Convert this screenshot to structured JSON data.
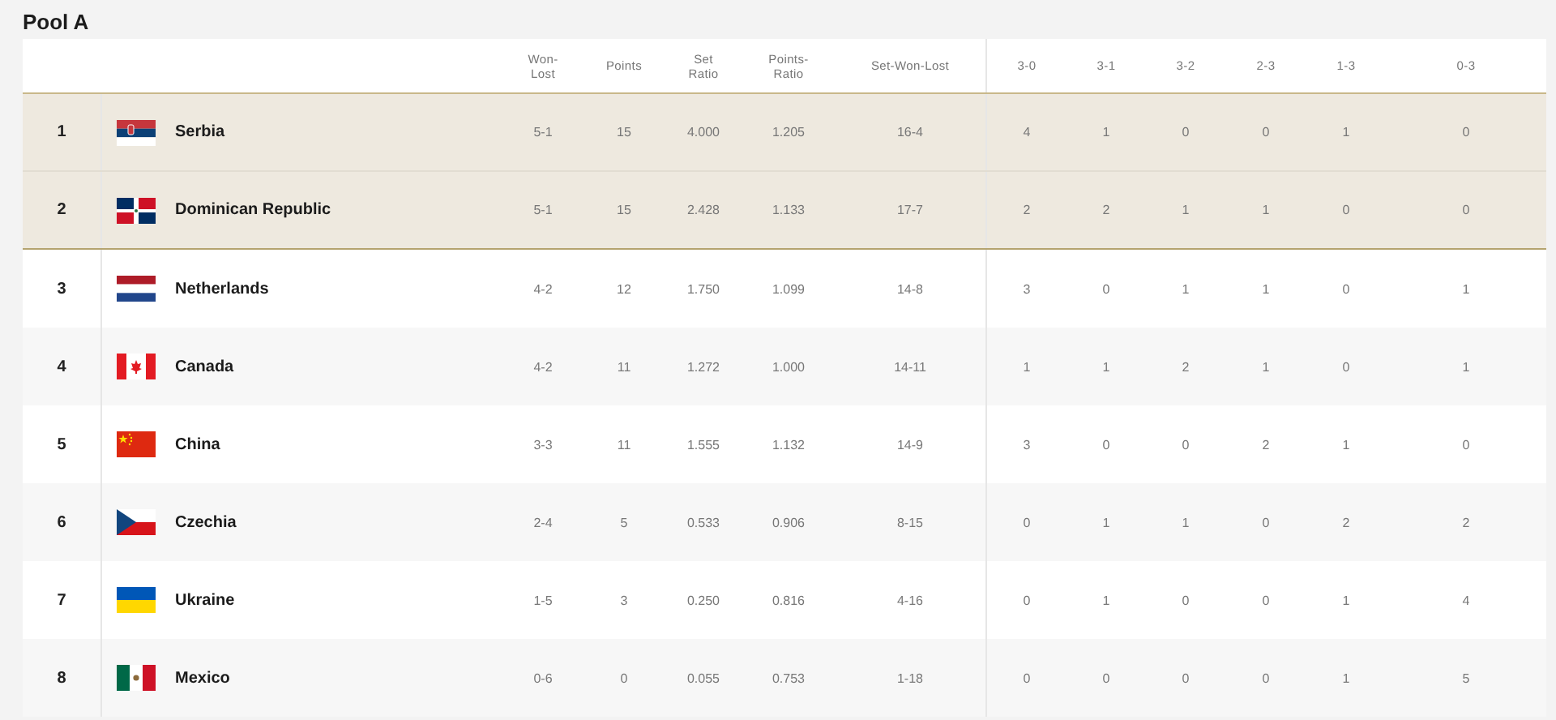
{
  "title": "Pool A",
  "columns": [
    "Won-\nLost",
    "Points",
    "Set\nRatio",
    "Points-\nRatio",
    "Set-Won-Lost",
    "3-0",
    "3-1",
    "3-2",
    "2-3",
    "1-3",
    "0-3"
  ],
  "rows": [
    {
      "rank": "1",
      "team": "Serbia",
      "highlighted": true,
      "stats": [
        "5-1",
        "15",
        "4.000",
        "1.205",
        "16-4",
        "4",
        "1",
        "0",
        "0",
        "1",
        "0"
      ]
    },
    {
      "rank": "2",
      "team": "Dominican Republic",
      "highlighted": true,
      "stats": [
        "5-1",
        "15",
        "2.428",
        "1.133",
        "17-7",
        "2",
        "2",
        "1",
        "1",
        "0",
        "0"
      ]
    },
    {
      "rank": "3",
      "team": "Netherlands",
      "highlighted": false,
      "stats": [
        "4-2",
        "12",
        "1.750",
        "1.099",
        "14-8",
        "3",
        "0",
        "1",
        "1",
        "0",
        "1"
      ]
    },
    {
      "rank": "4",
      "team": "Canada",
      "highlighted": false,
      "stats": [
        "4-2",
        "11",
        "1.272",
        "1.000",
        "14-11",
        "1",
        "1",
        "2",
        "1",
        "0",
        "1"
      ]
    },
    {
      "rank": "5",
      "team": "China",
      "highlighted": false,
      "stats": [
        "3-3",
        "11",
        "1.555",
        "1.132",
        "14-9",
        "3",
        "0",
        "0",
        "2",
        "1",
        "0"
      ]
    },
    {
      "rank": "6",
      "team": "Czechia",
      "highlighted": false,
      "stats": [
        "2-4",
        "5",
        "0.533",
        "0.906",
        "8-15",
        "0",
        "1",
        "1",
        "0",
        "2",
        "2"
      ]
    },
    {
      "rank": "7",
      "team": "Ukraine",
      "highlighted": false,
      "stats": [
        "1-5",
        "3",
        "0.250",
        "0.816",
        "4-16",
        "0",
        "1",
        "0",
        "0",
        "1",
        "4"
      ]
    },
    {
      "rank": "8",
      "team": "Mexico",
      "highlighted": false,
      "stats": [
        "0-6",
        "0",
        "0.055",
        "0.753",
        "1-18",
        "0",
        "0",
        "0",
        "0",
        "1",
        "5"
      ]
    }
  ]
}
